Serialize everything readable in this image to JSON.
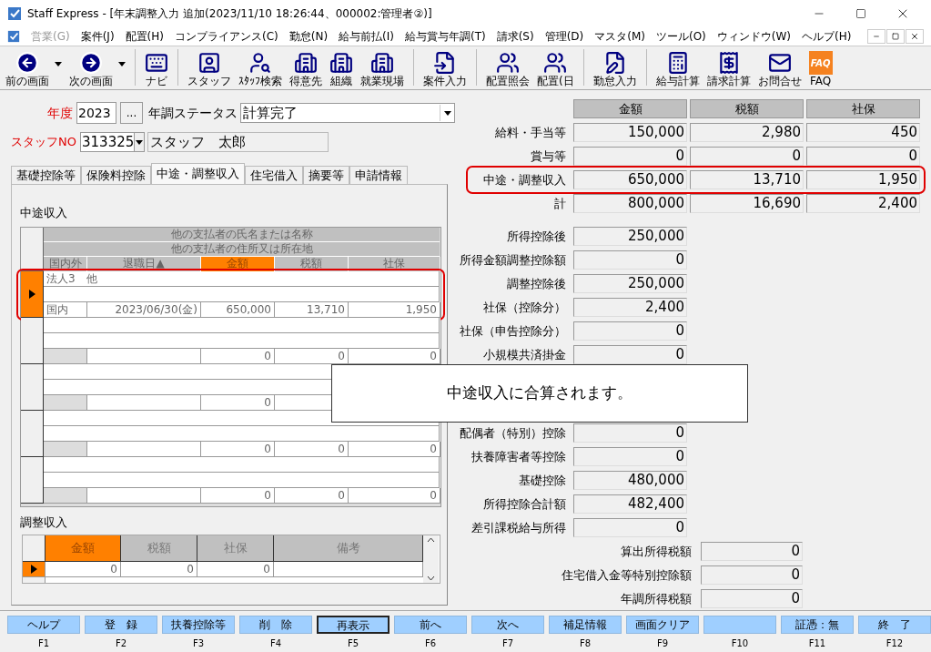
{
  "window": {
    "title": "Staff Express - [年末調整入力  追加(2023/11/10 18:26:44、000002:管理者②)]"
  },
  "menu": [
    {
      "label": "営業(G)",
      "disabled": true
    },
    {
      "label": "案件(J)",
      "disabled": false
    },
    {
      "label": "配置(H)",
      "disabled": false
    },
    {
      "label": "コンプライアンス(C)",
      "disabled": false
    },
    {
      "label": "勤怠(N)",
      "disabled": false
    },
    {
      "label": "給与前払(I)",
      "disabled": false
    },
    {
      "label": "給与賞与年調(T)",
      "disabled": false
    },
    {
      "label": "請求(S)",
      "disabled": false
    },
    {
      "label": "管理(D)",
      "disabled": false
    },
    {
      "label": "マスタ(M)",
      "disabled": false
    },
    {
      "label": "ツール(O)",
      "disabled": false
    },
    {
      "label": "ウィンドウ(W)",
      "disabled": false
    },
    {
      "label": "ヘルプ(H)",
      "disabled": false
    }
  ],
  "toolbar": [
    [
      {
        "label": "前の画面",
        "kind": "back",
        "dropdown": true
      },
      {
        "label": "次の画面",
        "kind": "forward",
        "dropdown": true
      }
    ],
    [
      {
        "label": "ナビ",
        "kind": "navi",
        "dropdown": false
      }
    ],
    [
      {
        "label": "スタッフ",
        "kind": "staff",
        "dropdown": false
      },
      {
        "label": "ｽﾀｯﾌ検索",
        "kind": "staff_search",
        "dropdown": false
      },
      {
        "label": "得意先",
        "kind": "building",
        "dropdown": false
      },
      {
        "label": "組織",
        "kind": "building",
        "dropdown": false
      },
      {
        "label": "就業現場",
        "kind": "building",
        "dropdown": false
      }
    ],
    [
      {
        "label": "案件入力",
        "kind": "case",
        "dropdown": false
      }
    ],
    [
      {
        "label": "配置照会",
        "kind": "assign",
        "dropdown": false
      },
      {
        "label": "配置(日",
        "kind": "assign",
        "dropdown": false
      }
    ],
    [
      {
        "label": "勤怠入力",
        "kind": "attendance",
        "dropdown": false
      }
    ],
    [
      {
        "label": "給与計算",
        "kind": "payroll",
        "dropdown": false
      },
      {
        "label": "請求計算",
        "kind": "billing",
        "dropdown": false
      },
      {
        "label": "お問合せ",
        "kind": "inquiry",
        "dropdown": false
      },
      {
        "label": "FAQ",
        "kind": "faq",
        "badge": "FAQ",
        "dropdown": false
      }
    ]
  ],
  "form": {
    "year_label": "年度",
    "year": "2023",
    "year_button": "...",
    "status_label": "年調ステータス",
    "status": "計算完了",
    "staff_label": "スタッフNO",
    "staff_no": "313325",
    "staff_name": "スタッフ　太郎"
  },
  "tabs": [
    {
      "label": "基礎控除等",
      "selected": false
    },
    {
      "label": "保険料控除",
      "selected": false
    },
    {
      "label": "中途・調整収入",
      "selected": true
    },
    {
      "label": "住宅借入",
      "selected": false
    },
    {
      "label": "摘要等",
      "selected": false
    },
    {
      "label": "申請情報",
      "selected": false
    }
  ],
  "mid_income": {
    "title": "中途収入",
    "header_name": "他の支払者の氏名または名称",
    "header_address": "他の支払者の住所又は所在地",
    "columns": [
      {
        "label": "国内外",
        "sorted": false
      },
      {
        "label": "退職日▲",
        "sorted": false
      },
      {
        "label": "金額",
        "sorted": true
      },
      {
        "label": "税額",
        "sorted": false
      },
      {
        "label": "社保",
        "sorted": false
      }
    ],
    "records": [
      {
        "selected": true,
        "highlighted": true,
        "name": "法人3　他",
        "region": "国内",
        "date": "2023/06/30(金)",
        "amount": "650,000",
        "tax": "13,710",
        "insurance": "1,950"
      },
      {
        "selected": false,
        "highlighted": false,
        "amount": "0",
        "tax": "0",
        "insurance": "0"
      },
      {
        "selected": false,
        "highlighted": false,
        "amount": "0"
      },
      {
        "selected": false,
        "highlighted": false,
        "amount": "0",
        "tax": "0",
        "insurance": "0"
      },
      {
        "selected": false,
        "highlighted": false,
        "amount": "0",
        "tax": "0",
        "insurance": "0"
      }
    ]
  },
  "adjustment_income": {
    "title": "調整収入",
    "columns": [
      {
        "label": "金額",
        "sorted": true
      },
      {
        "label": "税額",
        "sorted": false
      },
      {
        "label": "社保",
        "sorted": false
      },
      {
        "label": "備考",
        "sorted": false
      }
    ],
    "rows": [
      {
        "selected": true,
        "amount": "0",
        "tax": "0",
        "insurance": "0"
      }
    ]
  },
  "summary": {
    "columns": [
      "金額",
      "税額",
      "社保"
    ],
    "rows": [
      {
        "label": "給料・手当等",
        "values": [
          "150,000",
          "2,980",
          "450"
        ],
        "highlighted": false
      },
      {
        "label": "賞与等",
        "values": [
          "0",
          "0",
          "0"
        ],
        "highlighted": false
      },
      {
        "label": "中途・調整収入",
        "values": [
          "650,000",
          "13,710",
          "1,950"
        ],
        "highlighted": true
      },
      {
        "label": "計",
        "values": [
          "800,000",
          "16,690",
          "2,400"
        ],
        "highlighted": false
      }
    ]
  },
  "deductions_upper": [
    {
      "label": "所得控除後",
      "value": "250,000"
    },
    {
      "label": "所得金額調整控除額",
      "value": "0"
    },
    {
      "label": "調整控除後",
      "value": "250,000"
    },
    {
      "label": "社保（控除分）",
      "value": "2,400"
    },
    {
      "label": "社保（申告控除分）",
      "value": "0"
    },
    {
      "label": "小規模共済掛金",
      "value": "0"
    }
  ],
  "deductions_lower": [
    {
      "label": "配偶者（特別）控除",
      "value": "0"
    },
    {
      "label": "扶養障害者等控除",
      "value": "0"
    },
    {
      "label": "基礎控除",
      "value": "480,000"
    },
    {
      "label": "所得控除合計額",
      "value": "482,400"
    },
    {
      "label": "差引課税給与所得",
      "value": "0"
    }
  ],
  "tax_rows": [
    {
      "label": "算出所得税額",
      "value": "0"
    },
    {
      "label": "住宅借入金等特別控除額",
      "value": "0"
    },
    {
      "label": "年調所得税額",
      "value": "0"
    }
  ],
  "popup": {
    "message": "中途収入に合算されます。"
  },
  "function_keys": [
    {
      "label": "ヘルプ",
      "key": "F1",
      "selected": false
    },
    {
      "label": "登　録",
      "key": "F2",
      "selected": false
    },
    {
      "label": "扶養控除等",
      "key": "F3",
      "selected": false
    },
    {
      "label": "削　除",
      "key": "F4",
      "selected": false
    },
    {
      "label": "再表示",
      "key": "F5",
      "selected": true
    },
    {
      "label": "前へ",
      "key": "F6",
      "selected": false
    },
    {
      "label": "次へ",
      "key": "F7",
      "selected": false
    },
    {
      "label": "補足情報",
      "key": "F8",
      "selected": false
    },
    {
      "label": "画面クリア",
      "key": "F9",
      "selected": false
    },
    {
      "key": "F10",
      "selected": false
    },
    {
      "label": "証憑：無",
      "key": "F11",
      "selected": false
    },
    {
      "label": "終　了",
      "key": "F12",
      "selected": false
    }
  ]
}
